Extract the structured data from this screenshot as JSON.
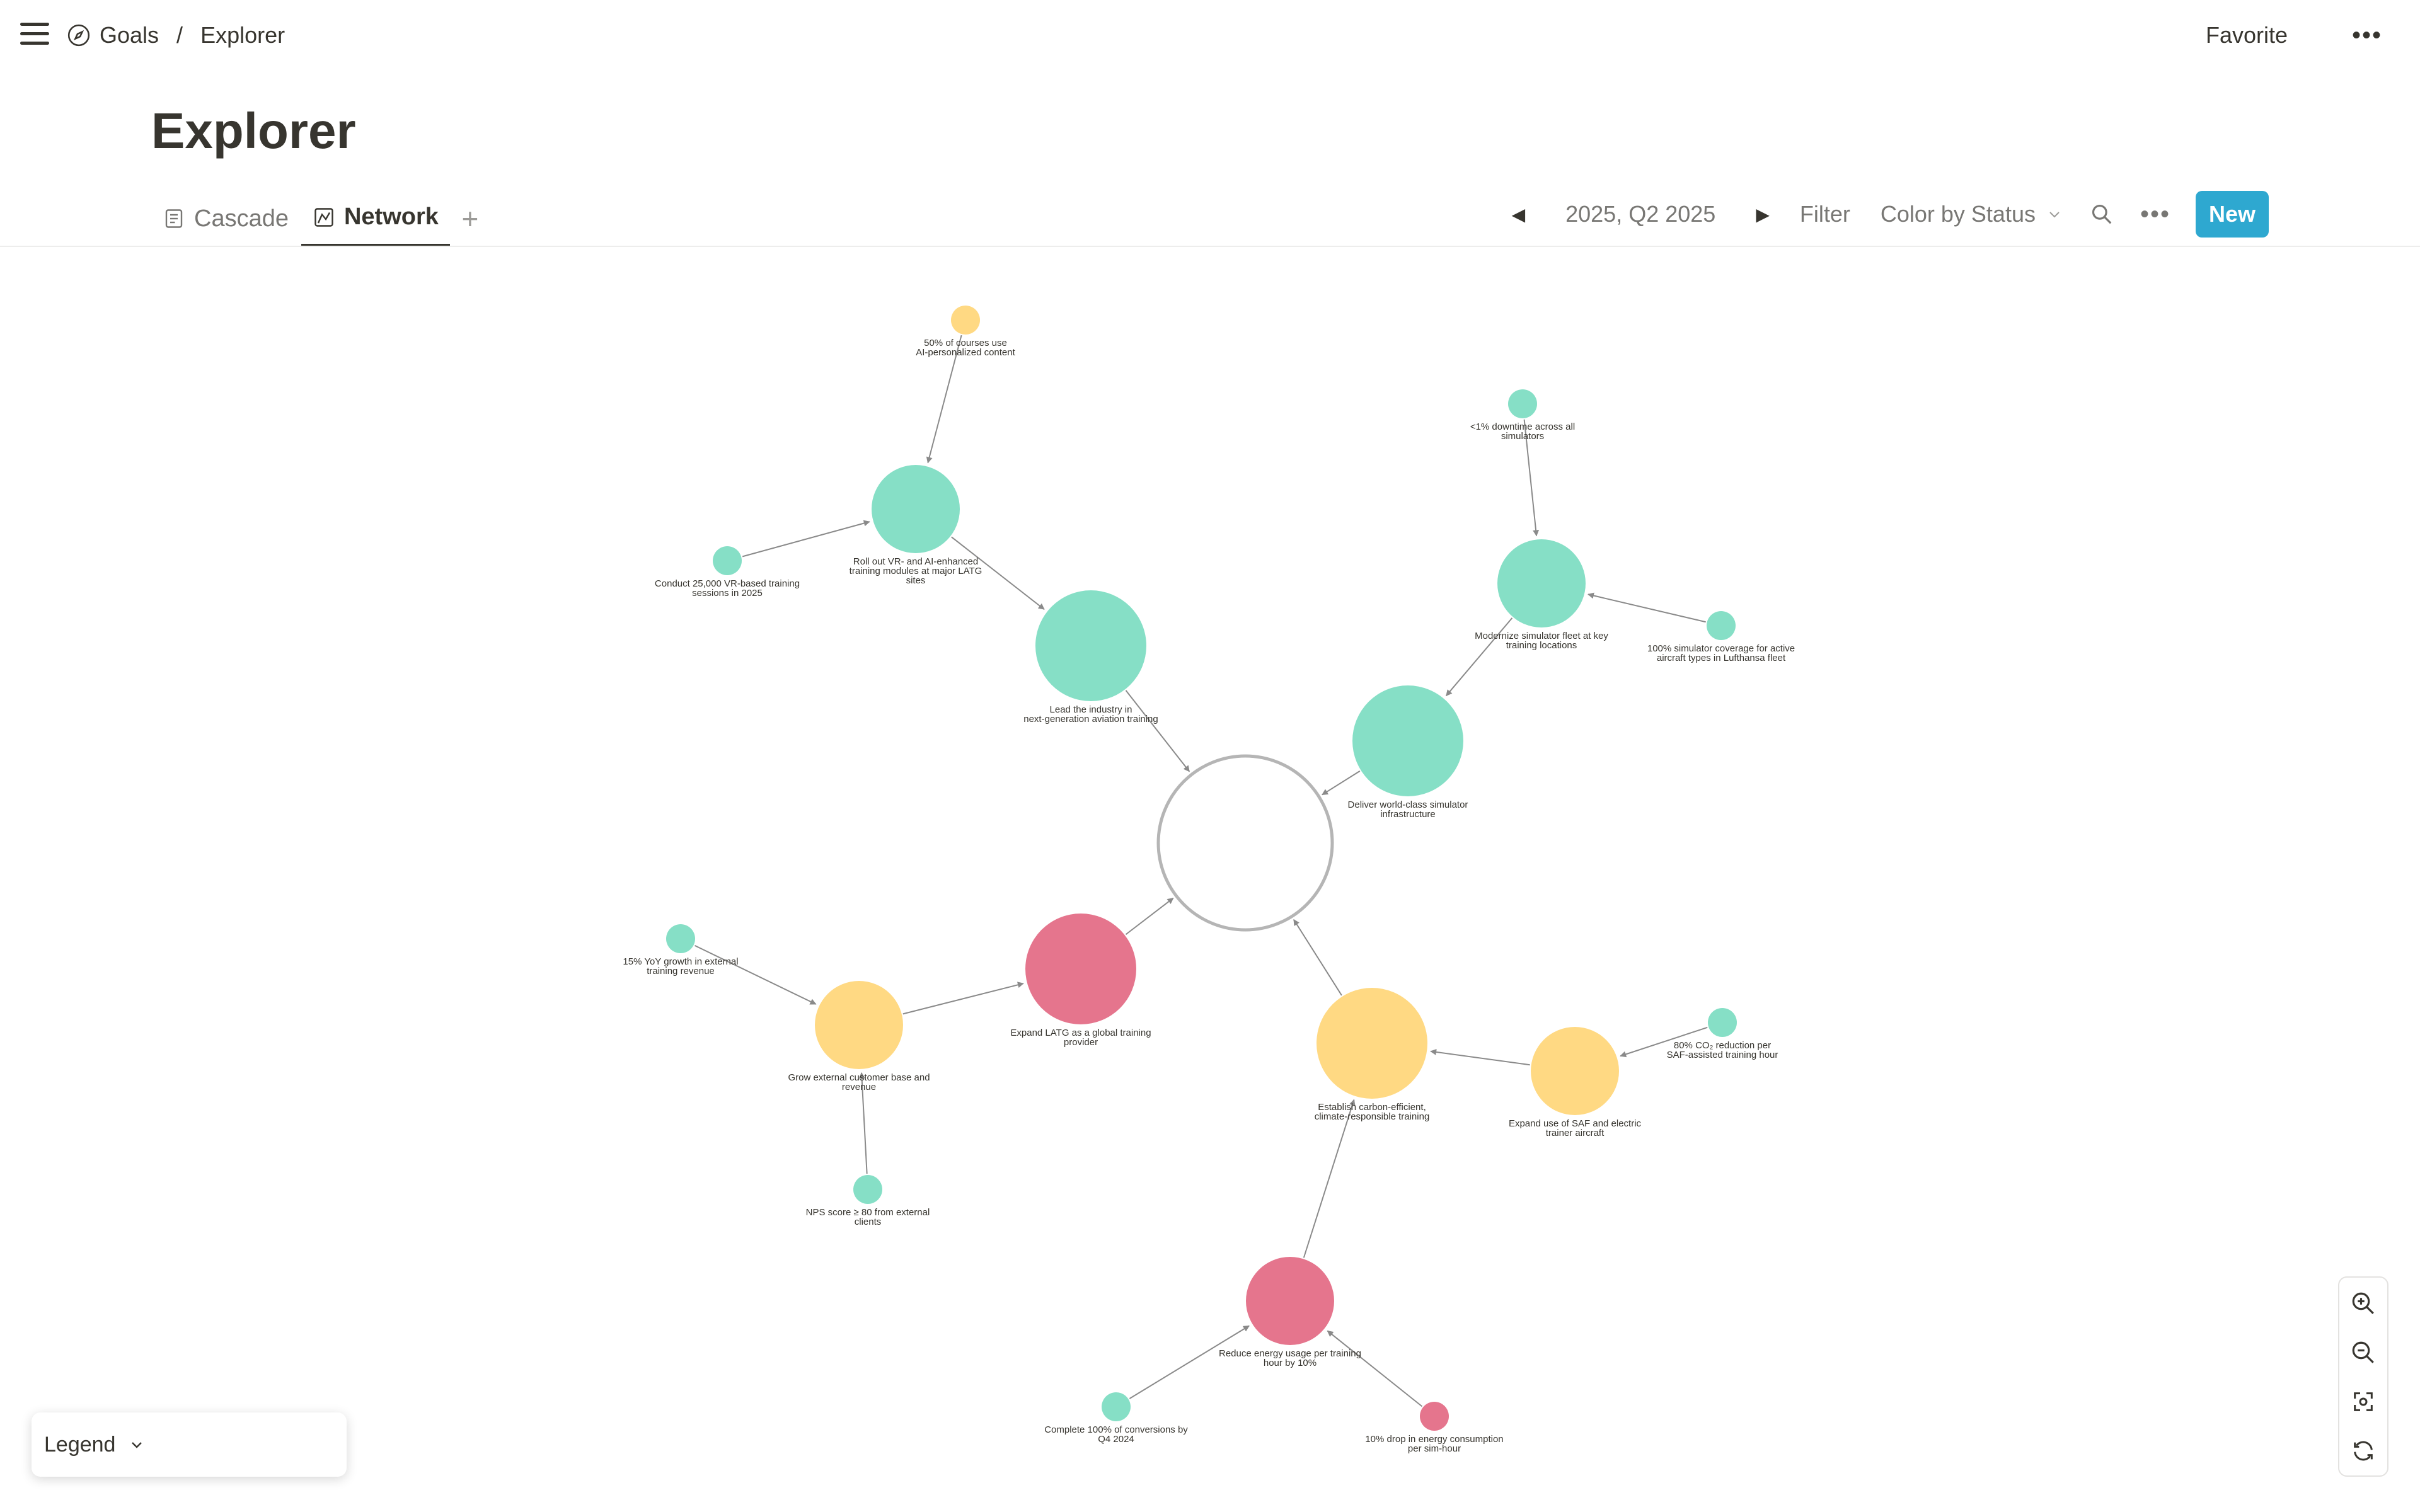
{
  "breadcrumb": {
    "root": "Goals",
    "separator": "/",
    "current": "Explorer"
  },
  "header": {
    "favorite": "Favorite",
    "more": "•••"
  },
  "page": {
    "title": "Explorer"
  },
  "tabs": [
    {
      "label": "Cascade"
    },
    {
      "label": "Network"
    }
  ],
  "tab_add": "+",
  "toolbar": {
    "prev": "◀",
    "period": "2025, Q2 2025",
    "next": "▶",
    "filter": "Filter",
    "color_by": "Color by Status",
    "more": "•••",
    "new": "New"
  },
  "legend": {
    "label": "Legend"
  },
  "colors": {
    "on_track": "#86dfc6",
    "at_risk": "#ffd983",
    "off_track": "#e5758d",
    "root_stroke": "#b5b5b5",
    "edge": "#8a8a8a",
    "accent": "#2ea8d0"
  },
  "icons": [
    "menu-icon",
    "compass-icon",
    "document-icon",
    "network-icon",
    "plus-icon",
    "search-icon",
    "chevron-down-icon",
    "zoom-in-icon",
    "zoom-out-icon",
    "fit-view-icon",
    "refresh-icon"
  ],
  "graph": {
    "nodes": [
      {
        "id": "root",
        "label": [],
        "status": "root"
      },
      {
        "id": "lead",
        "label": [
          "Lead the industry in",
          "next-generation aviation training"
        ],
        "status": "on_track"
      },
      {
        "id": "rollout",
        "label": [
          "Roll out VR- and AI-enhanced",
          "training modules at major LATG",
          "sites"
        ],
        "status": "on_track"
      },
      {
        "id": "ai50",
        "label": [
          "50% of courses use",
          "AI-personalized content"
        ],
        "status": "at_risk"
      },
      {
        "id": "vr25k",
        "label": [
          "Conduct 25,000 VR-based training",
          "sessions in 2025"
        ],
        "status": "on_track"
      },
      {
        "id": "deliver",
        "label": [
          "Deliver world-class simulator",
          "infrastructure"
        ],
        "status": "on_track"
      },
      {
        "id": "modernize",
        "label": [
          "Modernize simulator fleet at key",
          "training locations"
        ],
        "status": "on_track"
      },
      {
        "id": "downtime",
        "label": [
          "<1% downtime across all",
          "simulators"
        ],
        "status": "on_track"
      },
      {
        "id": "coverage",
        "label": [
          "100% simulator coverage for active",
          "aircraft types in Lufthansa fleet"
        ],
        "status": "on_track"
      },
      {
        "id": "expand",
        "label": [
          "Expand LATG as a global training",
          "provider"
        ],
        "status": "off_track"
      },
      {
        "id": "grow",
        "label": [
          "Grow external customer base and",
          "revenue"
        ],
        "status": "at_risk"
      },
      {
        "id": "yoy15",
        "label": [
          "15% YoY growth in external",
          "training revenue"
        ],
        "status": "on_track"
      },
      {
        "id": "nps",
        "label": [
          "NPS score ≥ 80 from external",
          "clients"
        ],
        "status": "on_track"
      },
      {
        "id": "carbon",
        "label": [
          "Establish carbon-efficient,",
          "climate-responsible training"
        ],
        "status": "at_risk"
      },
      {
        "id": "saf",
        "label": [
          "Expand use of SAF and electric",
          "trainer aircraft"
        ],
        "status": "at_risk"
      },
      {
        "id": "co2",
        "label": [
          "80% CO₂ reduction per",
          "SAF-assisted training hour"
        ],
        "status": "on_track"
      },
      {
        "id": "energy",
        "label": [
          "Reduce energy usage per training",
          "hour by 10%"
        ],
        "status": "off_track"
      },
      {
        "id": "conv",
        "label": [
          "Complete 100% of conversions by",
          "Q4 2024"
        ],
        "status": "on_track"
      },
      {
        "id": "drop10",
        "label": [
          "10% drop in energy consumption",
          "per sim-hour"
        ],
        "status": "off_track"
      }
    ],
    "edges": [
      [
        "ai50",
        "rollout"
      ],
      [
        "vr25k",
        "rollout"
      ],
      [
        "rollout",
        "lead"
      ],
      [
        "lead",
        "root"
      ],
      [
        "downtime",
        "modernize"
      ],
      [
        "coverage",
        "modernize"
      ],
      [
        "modernize",
        "deliver"
      ],
      [
        "deliver",
        "root"
      ],
      [
        "yoy15",
        "grow"
      ],
      [
        "nps",
        "grow"
      ],
      [
        "grow",
        "expand"
      ],
      [
        "expand",
        "root"
      ],
      [
        "co2",
        "saf"
      ],
      [
        "saf",
        "carbon"
      ],
      [
        "carbon",
        "root"
      ],
      [
        "conv",
        "energy"
      ],
      [
        "drop10",
        "energy"
      ],
      [
        "energy",
        "carbon"
      ]
    ]
  }
}
